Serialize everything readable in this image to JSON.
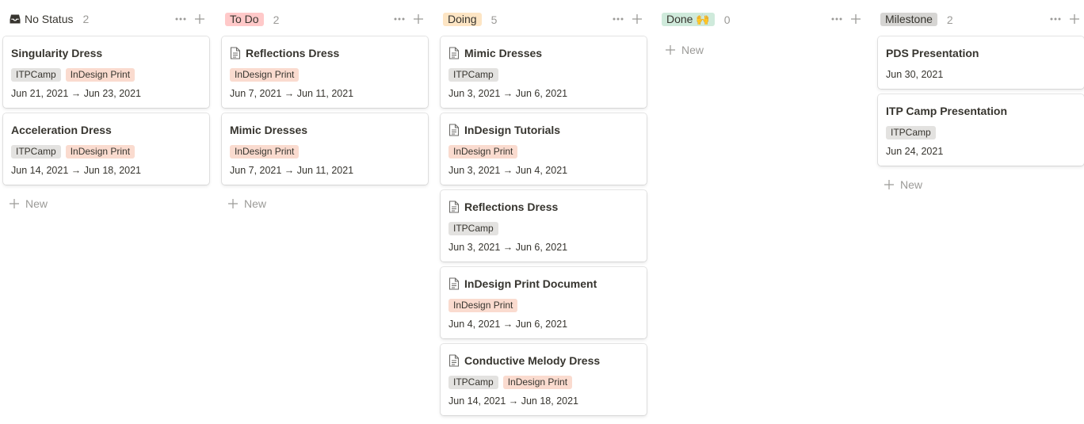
{
  "colors": {
    "tag_itpcamp": "#e3e2e0",
    "tag_indesign": "#fadbcf",
    "todo_pill": "#ffc9c9",
    "doing_pill": "#fde5c4",
    "done_pill": "#cfeadb",
    "milestone_pill": "#d6d5d3",
    "muted": "#9b9a97",
    "text": "#37352f"
  },
  "columns": [
    {
      "name": "No Status",
      "count": "2",
      "icon": "inbox-icon",
      "pill": false,
      "cards": [
        {
          "title": "Singularity Dress",
          "doc_icon": false,
          "tags": [
            "ITPCamp",
            "InDesign Print"
          ],
          "date": "Jun 21, 2021 → Jun 23, 2021"
        },
        {
          "title": "Acceleration Dress",
          "doc_icon": false,
          "tags": [
            "ITPCamp",
            "InDesign Print"
          ],
          "date": "Jun 14, 2021 → Jun 18, 2021"
        }
      ],
      "new_label": "New"
    },
    {
      "name": "To Do",
      "count": "2",
      "pill": true,
      "pill_color": "#ffc9c9",
      "cards": [
        {
          "title": "Reflections Dress",
          "doc_icon": true,
          "tags": [
            "InDesign Print"
          ],
          "date": "Jun 7, 2021 → Jun 11, 2021"
        },
        {
          "title": "Mimic Dresses",
          "doc_icon": false,
          "tags": [
            "InDesign Print"
          ],
          "date": "Jun 7, 2021 → Jun 11, 2021"
        }
      ],
      "new_label": "New"
    },
    {
      "name": "Doing",
      "count": "5",
      "pill": true,
      "pill_color": "#fde5c4",
      "cards": [
        {
          "title": "Mimic Dresses",
          "doc_icon": true,
          "tags": [
            "ITPCamp"
          ],
          "date": "Jun 3, 2021 → Jun 6, 2021"
        },
        {
          "title": "InDesign Tutorials",
          "doc_icon": true,
          "tags": [
            "InDesign Print"
          ],
          "date": "Jun 3, 2021 → Jun 4, 2021"
        },
        {
          "title": "Reflections Dress",
          "doc_icon": true,
          "tags": [
            "ITPCamp"
          ],
          "date": "Jun 3, 2021 → Jun 6, 2021"
        },
        {
          "title": "InDesign Print Document",
          "doc_icon": true,
          "tags": [
            "InDesign Print"
          ],
          "date": "Jun 4, 2021 → Jun 6, 2021"
        },
        {
          "title": "Conductive Melody Dress",
          "doc_icon": true,
          "tags": [
            "ITPCamp",
            "InDesign Print"
          ],
          "date": "Jun 14, 2021 → Jun 18, 2021"
        }
      ],
      "new_label": ""
    },
    {
      "name": "Done 🙌",
      "count": "0",
      "pill": true,
      "pill_color": "#cfeadb",
      "cards": [],
      "new_label": "New"
    },
    {
      "name": "Milestone",
      "count": "2",
      "pill": true,
      "pill_color": "#d6d5d3",
      "cards": [
        {
          "title": "PDS Presentation",
          "doc_icon": false,
          "tags": [],
          "date": "Jun 30, 2021"
        },
        {
          "title": "ITP Camp Presentation",
          "doc_icon": false,
          "tags": [
            "ITPCamp"
          ],
          "date": "Jun 24, 2021"
        }
      ],
      "new_label": "New"
    }
  ]
}
